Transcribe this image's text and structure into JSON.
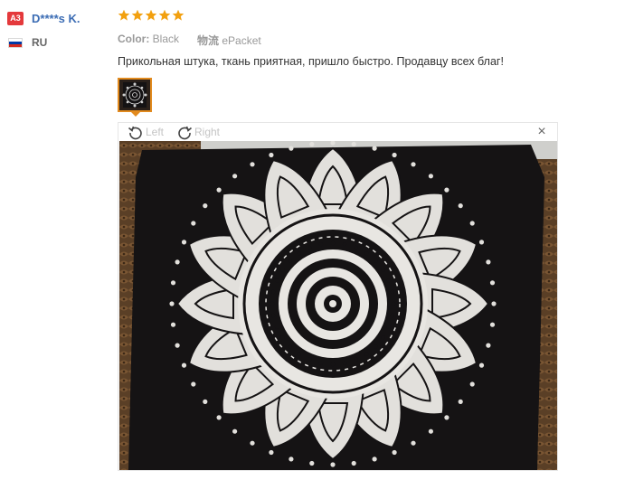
{
  "reviewer": {
    "avatar_initials": "A3",
    "name": "D****s K.",
    "country": "RU",
    "flag_colors": [
      "#ffffff",
      "#0039a6",
      "#d52b1e"
    ]
  },
  "rating": {
    "stars": 5,
    "max": 5,
    "color": "#f2a00f"
  },
  "attributes": {
    "color_label": "Color:",
    "color_value": "Black",
    "shipping_label": "物流",
    "shipping_value": "ePacket"
  },
  "review_text": "Прикольная штука, ткань приятная, пришло быстро. Продавцу всех благ!",
  "viewer": {
    "rotate_left_label": "Left",
    "rotate_right_label": "Right",
    "close_label": "×",
    "image_description_icon": "mandala-tapestry-photo"
  },
  "colors": {
    "accent_orange": "#e28a1e",
    "username_blue": "#3b6cb4",
    "badge_red": "#e4393c"
  }
}
